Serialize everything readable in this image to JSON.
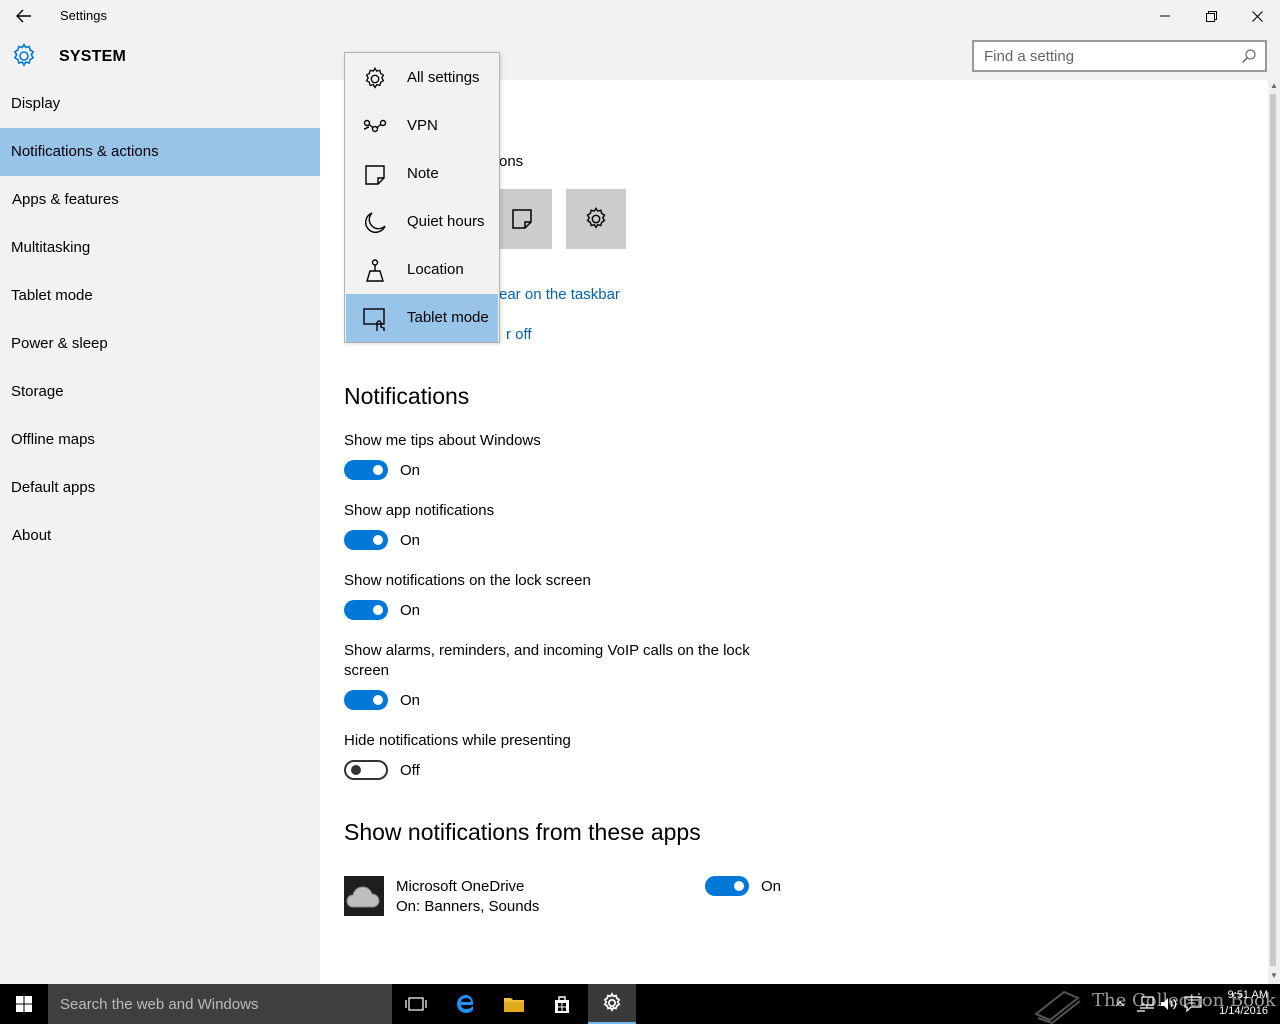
{
  "window": {
    "title": "Settings"
  },
  "header": {
    "title": "SYSTEM",
    "search_placeholder": "Find a setting"
  },
  "sidebar": {
    "items": [
      {
        "label": "Display"
      },
      {
        "label": "Notifications & actions"
      },
      {
        "label": "Apps & features"
      },
      {
        "label": "Multitasking"
      },
      {
        "label": "Tablet mode"
      },
      {
        "label": "Power & sleep"
      },
      {
        "label": "Storage"
      },
      {
        "label": "Offline maps"
      },
      {
        "label": "Default apps"
      },
      {
        "label": "About"
      }
    ],
    "active_index": 1
  },
  "quick_actions": {
    "partial_heading": "ons",
    "link1_partial": "ear on the taskbar",
    "link2_partial": "r off"
  },
  "menu": {
    "items": [
      {
        "label": "All settings",
        "icon": "gear-icon"
      },
      {
        "label": "VPN",
        "icon": "vpn-icon"
      },
      {
        "label": "Note",
        "icon": "note-icon"
      },
      {
        "label": "Quiet hours",
        "icon": "moon-icon"
      },
      {
        "label": "Location",
        "icon": "location-icon"
      },
      {
        "label": "Tablet mode",
        "icon": "tablet-mode-icon"
      }
    ],
    "selected_index": 5
  },
  "notifications": {
    "title": "Notifications",
    "settings": [
      {
        "label": "Show me tips about Windows",
        "state": "On",
        "on": true
      },
      {
        "label": "Show app notifications",
        "state": "On",
        "on": true
      },
      {
        "label": "Show notifications on the lock screen",
        "state": "On",
        "on": true
      },
      {
        "label": "Show alarms, reminders, and incoming VoIP calls on the lock screen",
        "state": "On",
        "on": true
      },
      {
        "label": "Hide notifications while presenting",
        "state": "Off",
        "on": false
      }
    ]
  },
  "apps": {
    "title": "Show notifications from these apps",
    "items": [
      {
        "name": "Microsoft OneDrive",
        "sub": "On: Banners, Sounds",
        "state": "On",
        "on": true
      }
    ]
  },
  "taskbar": {
    "search_placeholder": "Search the web and Windows",
    "watermark": "The Collection Book",
    "time": "9:51 AM",
    "date": "1/14/2016"
  },
  "colors": {
    "accent": "#0078d7",
    "selection": "#99c4ea",
    "link": "#0063b1"
  }
}
